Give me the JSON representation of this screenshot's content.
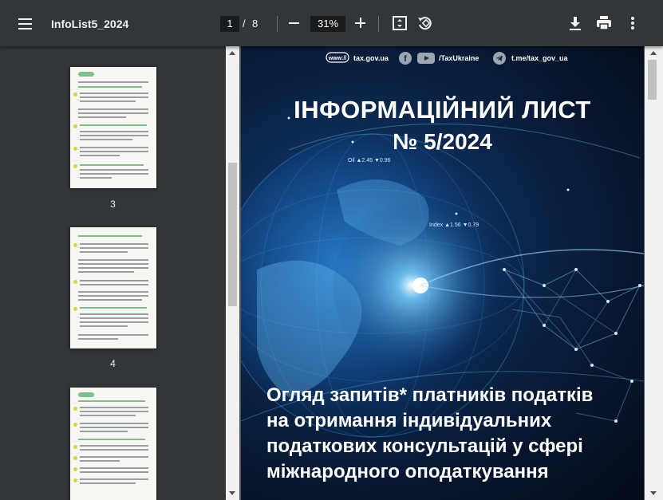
{
  "toolbar": {
    "title": "InfoList5_2024",
    "current_page": "1",
    "separator": "/",
    "total_pages": "8",
    "zoom": "31%"
  },
  "thumbnails": [
    {
      "label": "3"
    },
    {
      "label": "4"
    }
  ],
  "document": {
    "site": "tax.gov.ua",
    "social_handle": "/TaxUkraine",
    "telegram": "t.me/tax_gov_ua",
    "title_line1": "ІНФОРМАЦІЙНИЙ ЛИСТ",
    "title_line2": "№ 5/2024",
    "subtitle_lines": [
      "Огляд запитів* платників податків",
      "на отримання індивідуальних",
      "податкових консультацій у сфері",
      "міжнародного оподаткування"
    ],
    "ticker_oil": "Oil  ▲2.45  ▼0.96",
    "ticker_index": "Index  ▲1.56  ▼0.79"
  },
  "icons": {
    "menu": "menu-icon",
    "zoom_out": "minus-icon",
    "zoom_in": "plus-icon",
    "fit": "fit-to-page-icon",
    "rotate": "rotate-icon",
    "download": "download-icon",
    "print": "print-icon",
    "more": "more-vert-icon"
  }
}
